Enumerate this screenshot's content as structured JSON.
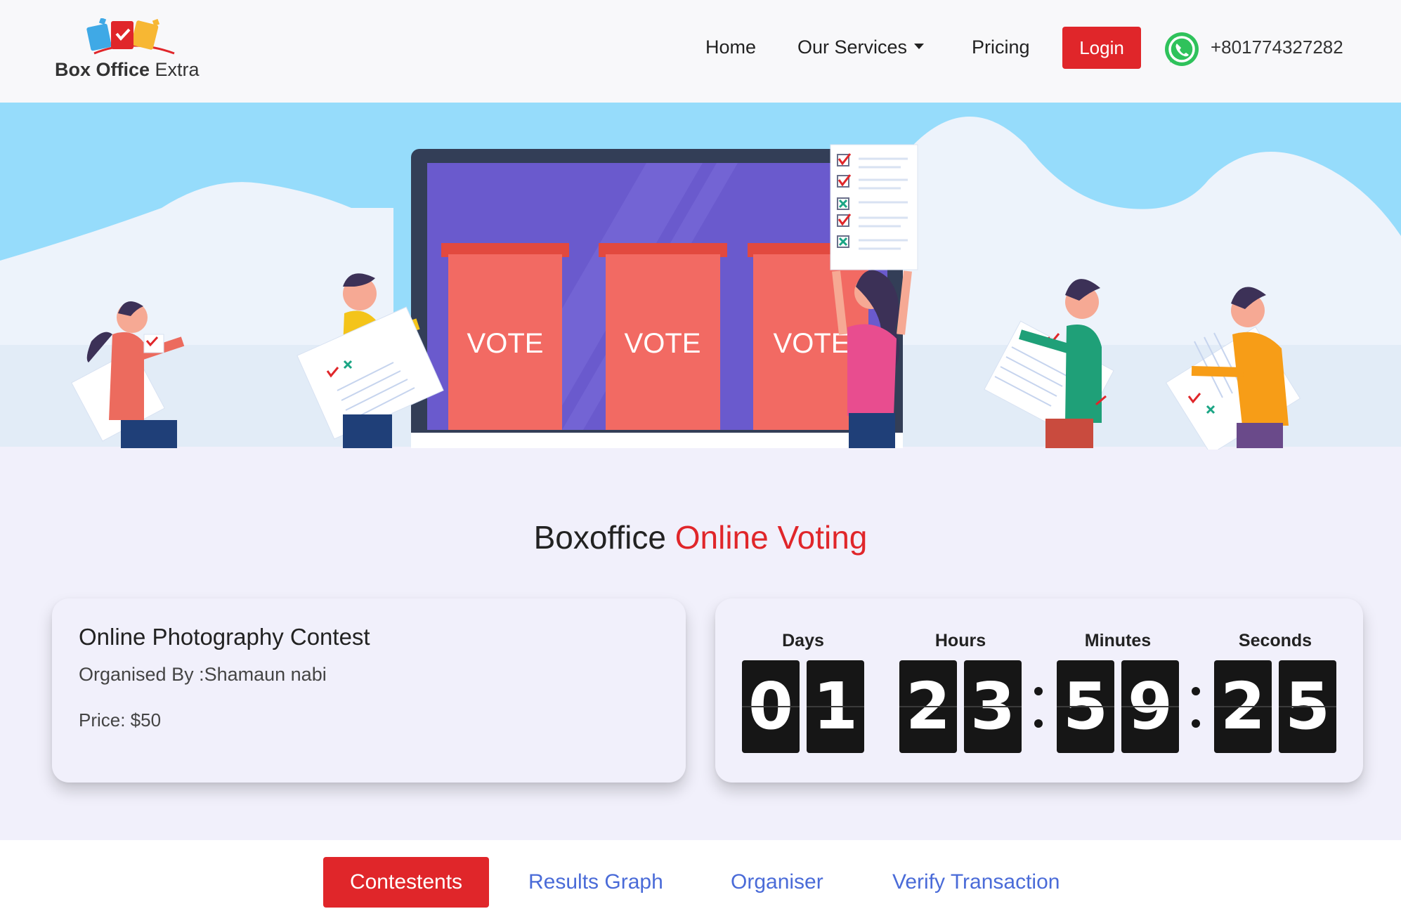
{
  "header": {
    "logo_text_bold": "Box Office",
    "logo_text_light": "Extra",
    "nav": [
      {
        "label": "Home"
      },
      {
        "label": "Our Services",
        "has_dropdown": true
      },
      {
        "label": "Pricing"
      }
    ],
    "login_label": "Login",
    "phone": "+801774327282",
    "phone_icon": "whatsapp-icon"
  },
  "hero": {
    "ballot_boxes": [
      "VOTE",
      "VOTE",
      "VOTE"
    ]
  },
  "section_title": {
    "prefix": "Boxoffice",
    "accent": "Online Voting"
  },
  "contest": {
    "name": "Online Photography Contest",
    "organiser": "Organised By :Shamaun nabi",
    "price": "Price: $50"
  },
  "countdown": {
    "labels": {
      "days": "Days",
      "hours": "Hours",
      "minutes": "Minutes",
      "seconds": "Seconds"
    },
    "days": [
      "0",
      "1"
    ],
    "hours": [
      "2",
      "3"
    ],
    "minutes": [
      "5",
      "9"
    ],
    "seconds": [
      "2",
      "5"
    ]
  },
  "tabs": [
    {
      "label": "Contestents",
      "active": true
    },
    {
      "label": "Results Graph",
      "active": false
    },
    {
      "label": "Organiser",
      "active": false
    },
    {
      "label": "Verify Transaction",
      "active": false
    }
  ],
  "colors": {
    "accent": "#e0262a",
    "link": "#4a6bd8",
    "hero_sky": "#96dcfb",
    "whatsapp": "#2fc25b"
  }
}
